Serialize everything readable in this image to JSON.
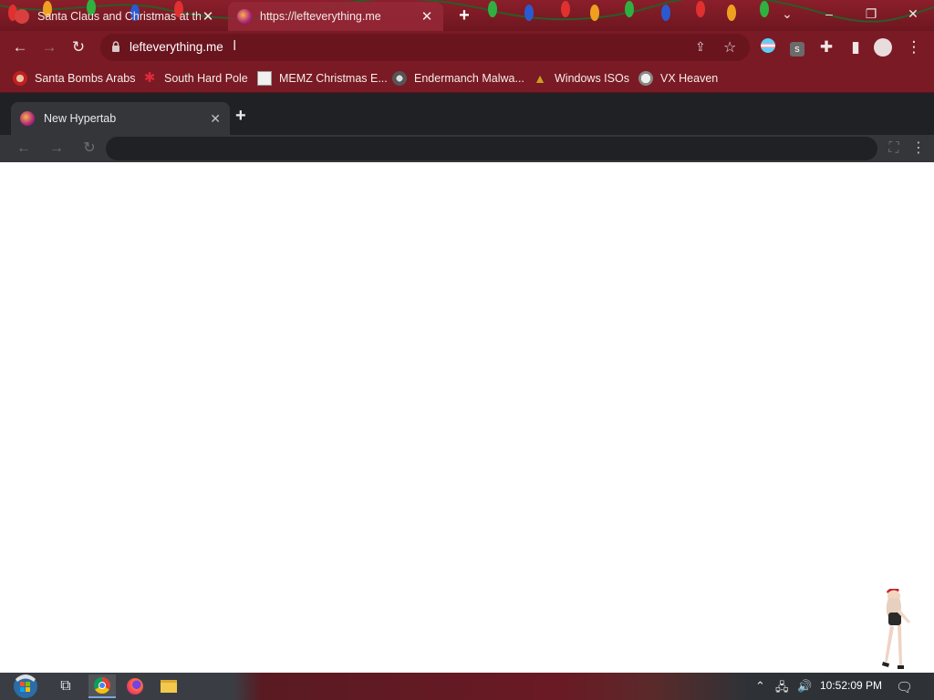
{
  "browser": {
    "tabs": [
      {
        "title": "Santa Claus and Christmas at the",
        "active": false
      },
      {
        "title": "https://lefteverything.me",
        "active": true
      }
    ],
    "url": "lefteverything.me",
    "theme_colors": {
      "frame": "#7a1a24",
      "frame_dark": "#6e1620"
    }
  },
  "bookmarks": [
    {
      "label": "Santa Bombs Arabs",
      "icon": "santa-icon"
    },
    {
      "label": "South Hard Pole",
      "icon": "snowflake-icon"
    },
    {
      "label": "MEMZ Christmas E...",
      "icon": "window-icon"
    },
    {
      "label": "Endermanch Malwa...",
      "icon": "raccoon-icon"
    },
    {
      "label": "Windows ISOs",
      "icon": "tree-icon"
    },
    {
      "label": "VX Heaven",
      "icon": "skull-icon"
    }
  ],
  "hypertab": {
    "tab_title": "New Hypertab"
  },
  "taskbar": {
    "clock": "10:52:09 PM",
    "apps": [
      "start-button",
      "task-view",
      "chrome",
      "firefox",
      "file-explorer"
    ]
  }
}
